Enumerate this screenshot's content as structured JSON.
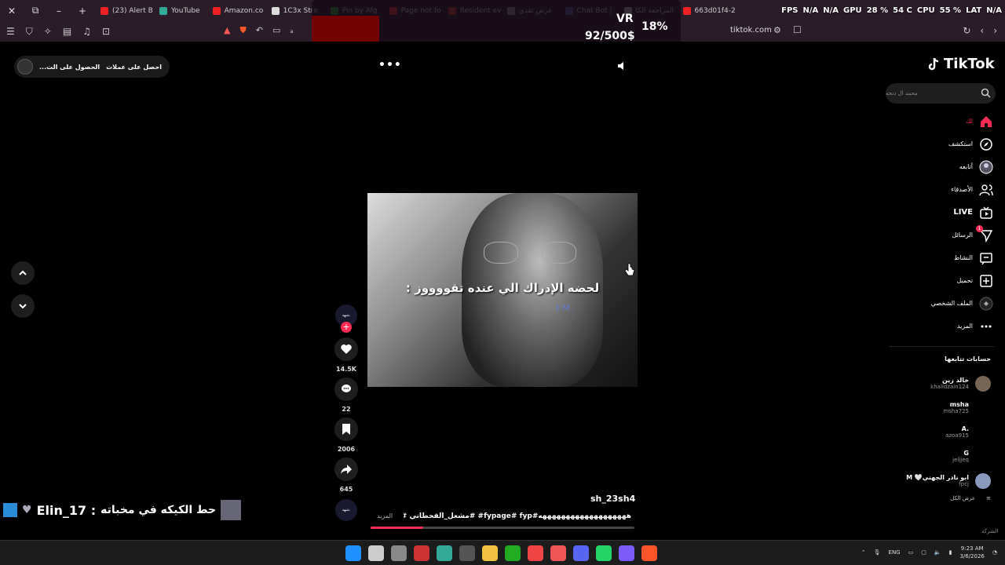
{
  "tabs": [
    {
      "label": "(23) Alert B",
      "color": "#e22"
    },
    {
      "label": "YouTube",
      "color": "#3a9"
    },
    {
      "label": "Amazon.co",
      "color": "#e22"
    },
    {
      "label": "1C3x Stre",
      "color": "#ddd"
    },
    {
      "label": "Pin by Afg",
      "color": "#3a3"
    },
    {
      "label": "Page not fo",
      "color": "#e33"
    },
    {
      "label": "Resident ev",
      "color": "#c33"
    },
    {
      "label": "عرض تقدي",
      "color": "#999"
    },
    {
      "label": "Chat Bot |",
      "color": "#55a"
    },
    {
      "label": "المراجعة الكا",
      "color": "#bbb"
    },
    {
      "label": "663d01f4-2",
      "color": "#e22"
    }
  ],
  "overlay": {
    "fps": "FPS",
    "fps_val": "N/A",
    "na2": "N/A",
    "gpu": "GPU",
    "gpu_val": "28 %",
    "gpu_temp": "54 C",
    "cpu": "CPU",
    "cpu_val": "55 %",
    "lat": "LAT",
    "lat_val": "N/A"
  },
  "vr_popup": {
    "vr": "VR",
    "money": "92/500$",
    "percent": "18%"
  },
  "address": {
    "url": "tiktok.com"
  },
  "top_pill": {
    "label1": "احصل على عملات",
    "label2": "الحصول على الت..."
  },
  "video": {
    "caption": "لحضه الإدراك الي عنده تقووووز :",
    "watermark": "FM."
  },
  "actions": {
    "creator_tag": "شهد.",
    "likes": "14.5K",
    "comments": "22",
    "saves": "2006",
    "shares": "645"
  },
  "post": {
    "author": "sh_23sh4",
    "description": "هههههههههههههههههههه#fypage# fyp# #مشعل_القحطاني #محمد...",
    "more": "المزيد",
    "progress": 0.2
  },
  "sidebar": {
    "logo": "TikTok",
    "search_placeholder": "محمد ال دنحه",
    "nav": [
      {
        "label": "لك",
        "icon": "home-icon",
        "active": true
      },
      {
        "label": "استكشف",
        "icon": "compass-icon"
      },
      {
        "label": "أتابعه",
        "icon": "following-avatar-icon"
      },
      {
        "label": "الأصدقاء",
        "icon": "friends-icon"
      },
      {
        "label": "LIVE",
        "icon": "live-icon",
        "live": true
      },
      {
        "label": "الرسائل",
        "icon": "messages-icon",
        "badge": "1"
      },
      {
        "label": "النشاط",
        "icon": "activity-icon"
      },
      {
        "label": "تحميل",
        "icon": "upload-icon"
      },
      {
        "label": "الملف الشخصي",
        "icon": "profile-avatar-icon"
      },
      {
        "label": "المزيد",
        "icon": "more-dots-icon"
      }
    ],
    "following_title": "حسابات تتابعها",
    "following": [
      {
        "name": "خالد زين",
        "handle": "khalidzain124",
        "color": "#776655"
      },
      {
        "name": "msha",
        "handle": "msha725",
        "color": "#000000"
      },
      {
        "name": "A.",
        "handle": "azoa915",
        "color": "#000000"
      },
      {
        "name": "G",
        "handle": "jeljjeq",
        "color": "#000000"
      },
      {
        "name": "M 🤍ابو نادر الجهني",
        "handle": "fpcj",
        "color": "#8899bb"
      }
    ],
    "see_all": "عرض الكل",
    "company": "الشركة"
  },
  "stream_overlay": {
    "username": "Elin_17 :",
    "message": "حط الكيكه في مخباته"
  },
  "taskbar": {
    "lang": "ENG",
    "time": "9:23 AM",
    "date": "3/6/2026",
    "apps": [
      "#1e90ff",
      "#ccc",
      "#888",
      "#c33",
      "#3a9",
      "#555",
      "#f0c040",
      "#2a2",
      "#e44",
      "#e55",
      "#5865f2",
      "#25d366",
      "#7a5af8",
      "#fb542b"
    ]
  }
}
